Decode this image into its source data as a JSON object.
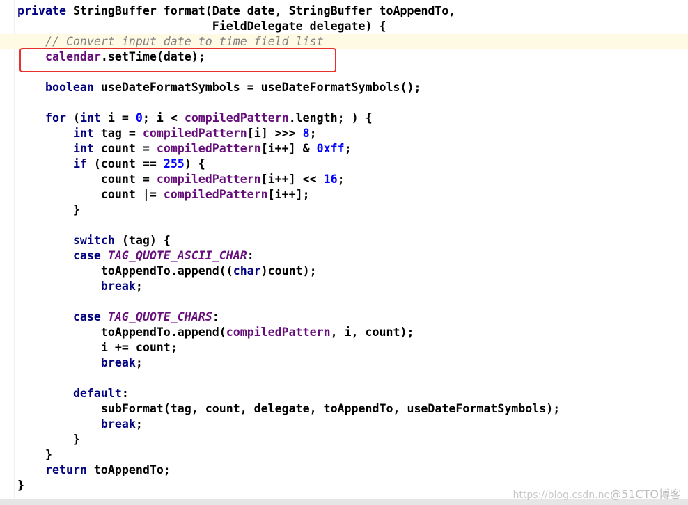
{
  "editor": {
    "highlighted_line": 3,
    "boxed_line": 4,
    "accent_box_color": "#e8312d",
    "lines": [
      [
        [
          "private ",
          "kw"
        ],
        [
          "StringBuffer format(Date date, StringBuffer toAppendTo,",
          "plain"
        ]
      ],
      [
        [
          "                            FieldDelegate delegate) {",
          "plain"
        ]
      ],
      [
        [
          "    ",
          "plain"
        ],
        [
          "// Convert input date to time field list",
          "cmt"
        ]
      ],
      [
        [
          "    ",
          "plain"
        ],
        [
          "calendar",
          "fld"
        ],
        [
          ".setTime(date);",
          "plain"
        ]
      ],
      [],
      [
        [
          "    ",
          "plain"
        ],
        [
          "boolean ",
          "kw"
        ],
        [
          "useDateFormatSymbols = useDateFormatSymbols();",
          "plain"
        ]
      ],
      [],
      [
        [
          "    ",
          "plain"
        ],
        [
          "for ",
          "kw"
        ],
        [
          "(",
          "plain"
        ],
        [
          "int ",
          "kw"
        ],
        [
          "i = ",
          "plain"
        ],
        [
          "0",
          "num"
        ],
        [
          "; i < ",
          "plain"
        ],
        [
          "compiledPattern",
          "fld"
        ],
        [
          ".length; ) {",
          "plain"
        ]
      ],
      [
        [
          "        ",
          "plain"
        ],
        [
          "int ",
          "kw"
        ],
        [
          "tag = ",
          "plain"
        ],
        [
          "compiledPattern",
          "fld"
        ],
        [
          "[i] >>> ",
          "plain"
        ],
        [
          "8",
          "num"
        ],
        [
          ";",
          "plain"
        ]
      ],
      [
        [
          "        ",
          "plain"
        ],
        [
          "int ",
          "kw"
        ],
        [
          "count = ",
          "plain"
        ],
        [
          "compiledPattern",
          "fld"
        ],
        [
          "[i++] & ",
          "plain"
        ],
        [
          "0xff",
          "num"
        ],
        [
          ";",
          "plain"
        ]
      ],
      [
        [
          "        ",
          "plain"
        ],
        [
          "if ",
          "kw"
        ],
        [
          "(count == ",
          "plain"
        ],
        [
          "255",
          "num"
        ],
        [
          ") {",
          "plain"
        ]
      ],
      [
        [
          "            count = ",
          "plain"
        ],
        [
          "compiledPattern",
          "fld"
        ],
        [
          "[i++] << ",
          "plain"
        ],
        [
          "16",
          "num"
        ],
        [
          ";",
          "plain"
        ]
      ],
      [
        [
          "            count |= ",
          "plain"
        ],
        [
          "compiledPattern",
          "fld"
        ],
        [
          "[i++];",
          "plain"
        ]
      ],
      [
        [
          "        }",
          "plain"
        ]
      ],
      [],
      [
        [
          "        ",
          "plain"
        ],
        [
          "switch ",
          "kw"
        ],
        [
          "(tag) {",
          "plain"
        ]
      ],
      [
        [
          "        ",
          "plain"
        ],
        [
          "case ",
          "kw"
        ],
        [
          "TAG_QUOTE_ASCII_CHAR",
          "const"
        ],
        [
          ":",
          "plain"
        ]
      ],
      [
        [
          "            toAppendTo.append((",
          "plain"
        ],
        [
          "char",
          "kw"
        ],
        [
          ")count);",
          "plain"
        ]
      ],
      [
        [
          "            ",
          "plain"
        ],
        [
          "break",
          "kw"
        ],
        [
          ";",
          "plain"
        ]
      ],
      [],
      [
        [
          "        ",
          "plain"
        ],
        [
          "case ",
          "kw"
        ],
        [
          "TAG_QUOTE_CHARS",
          "const"
        ],
        [
          ":",
          "plain"
        ]
      ],
      [
        [
          "            toAppendTo.append(",
          "plain"
        ],
        [
          "compiledPattern",
          "fld"
        ],
        [
          ", i, count);",
          "plain"
        ]
      ],
      [
        [
          "            i += count;",
          "plain"
        ]
      ],
      [
        [
          "            ",
          "plain"
        ],
        [
          "break",
          "kw"
        ],
        [
          ";",
          "plain"
        ]
      ],
      [],
      [
        [
          "        ",
          "plain"
        ],
        [
          "default",
          "kw"
        ],
        [
          ":",
          "plain"
        ]
      ],
      [
        [
          "            subFormat(tag, count, delegate, toAppendTo, useDateFormatSymbols);",
          "plain"
        ]
      ],
      [
        [
          "            ",
          "plain"
        ],
        [
          "break",
          "kw"
        ],
        [
          ";",
          "plain"
        ]
      ],
      [
        [
          "        }",
          "plain"
        ]
      ],
      [
        [
          "    }",
          "plain"
        ]
      ],
      [
        [
          "    ",
          "plain"
        ],
        [
          "return ",
          "kw"
        ],
        [
          "toAppendTo;",
          "plain"
        ]
      ],
      [
        [
          "}",
          "plain"
        ]
      ]
    ]
  },
  "watermark": {
    "url": "https://blog.csdn.ne",
    "brand": "@51CTO博客"
  }
}
